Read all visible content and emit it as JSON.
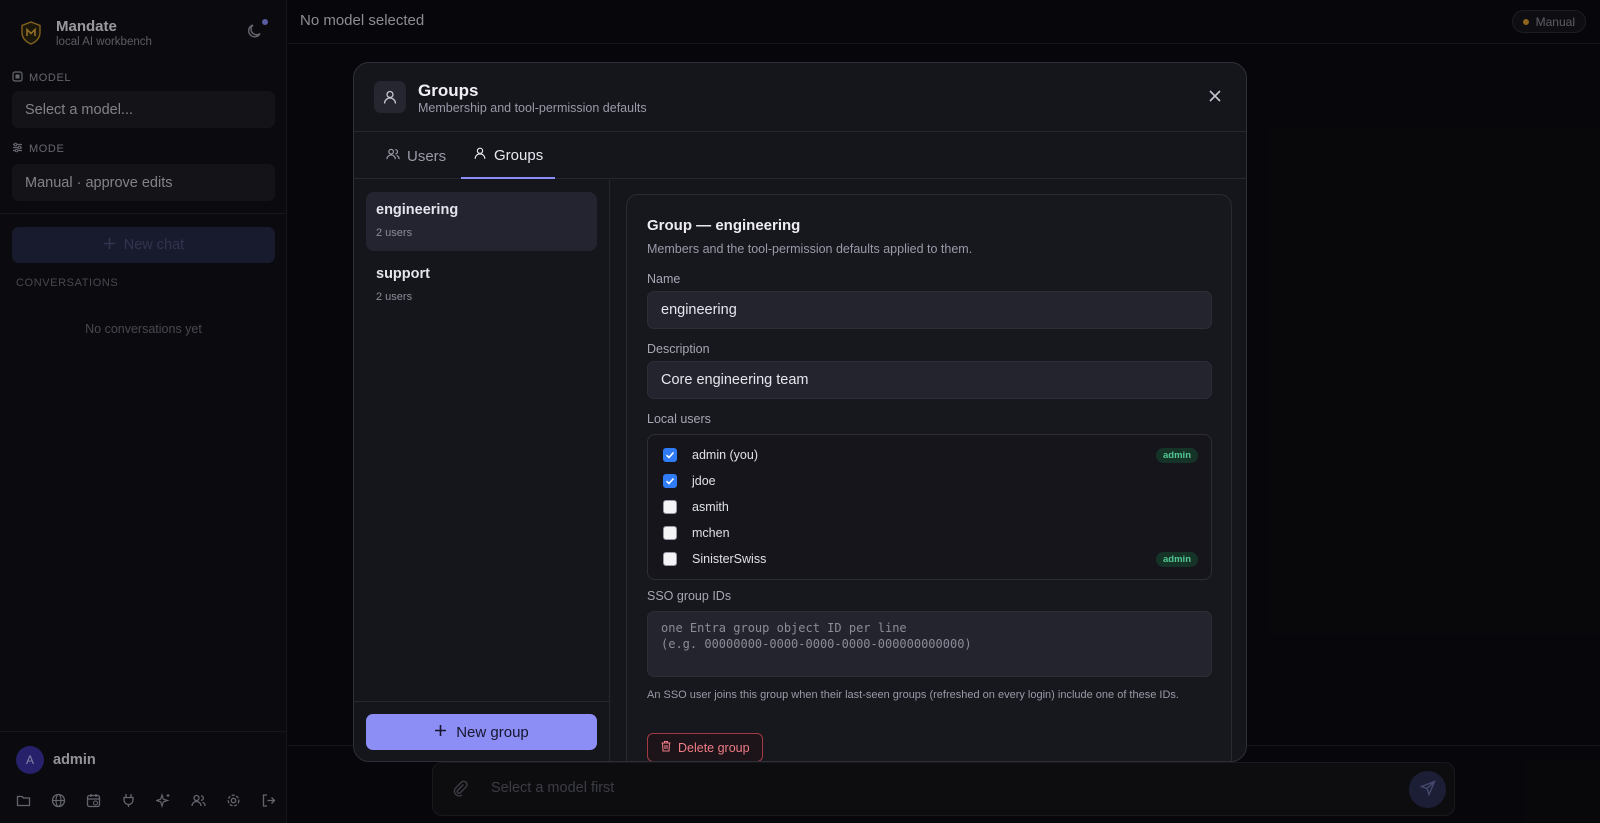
{
  "app": {
    "name": "Mandate",
    "tagline": "local AI workbench"
  },
  "sidebar": {
    "model_label": "MODEL",
    "model_value": "Select a model...",
    "mode_label": "MODE",
    "mode_value": "Manual · approve edits",
    "new_chat_label": "New chat",
    "conversations_label": "CONVERSATIONS",
    "conversations_empty": "No conversations yet",
    "user": {
      "initial": "A",
      "name": "admin"
    },
    "bottom_icons": [
      "folder-icon",
      "globe-icon",
      "calendar-icon",
      "plug-icon",
      "sparkle-icon",
      "users-icon",
      "gear-icon",
      "logout-icon"
    ]
  },
  "topbar": {
    "title": "No model selected",
    "mode_pill": "Manual"
  },
  "composer": {
    "placeholder": "Select a model first"
  },
  "modal": {
    "title": "Groups",
    "subtitle": "Membership and tool-permission defaults",
    "tabs": [
      {
        "label": "Users",
        "active": false
      },
      {
        "label": "Groups",
        "active": true
      }
    ],
    "groups": [
      {
        "name": "engineering",
        "count": "2 users",
        "active": true
      },
      {
        "name": "support",
        "count": "2 users",
        "active": false
      }
    ],
    "new_group_label": "New group",
    "detail": {
      "title": "Group — engineering",
      "subtitle": "Members and the tool-permission defaults applied to them.",
      "name_label": "Name",
      "name_value": "engineering",
      "description_label": "Description",
      "description_value": "Core engineering team",
      "local_users_label": "Local users",
      "users": [
        {
          "name": "admin (you)",
          "checked": true,
          "badge": "admin"
        },
        {
          "name": "jdoe",
          "checked": true,
          "badge": ""
        },
        {
          "name": "asmith",
          "checked": false,
          "badge": ""
        },
        {
          "name": "mchen",
          "checked": false,
          "badge": ""
        },
        {
          "name": "SinisterSwiss",
          "checked": false,
          "badge": "admin"
        }
      ],
      "sso_label": "SSO group IDs",
      "sso_placeholder": "one Entra group object ID per line\n(e.g. 00000000-0000-0000-0000-000000000000)",
      "sso_help": "An SSO user joins this group when their last-seen groups (refreshed on every login) include one of these IDs.",
      "delete_label": "Delete group"
    }
  },
  "colors": {
    "accent": "#8c8ef5",
    "danger": "#ef7c86",
    "badge_green": "#52c792",
    "mode_dot": "#d89a2a"
  }
}
